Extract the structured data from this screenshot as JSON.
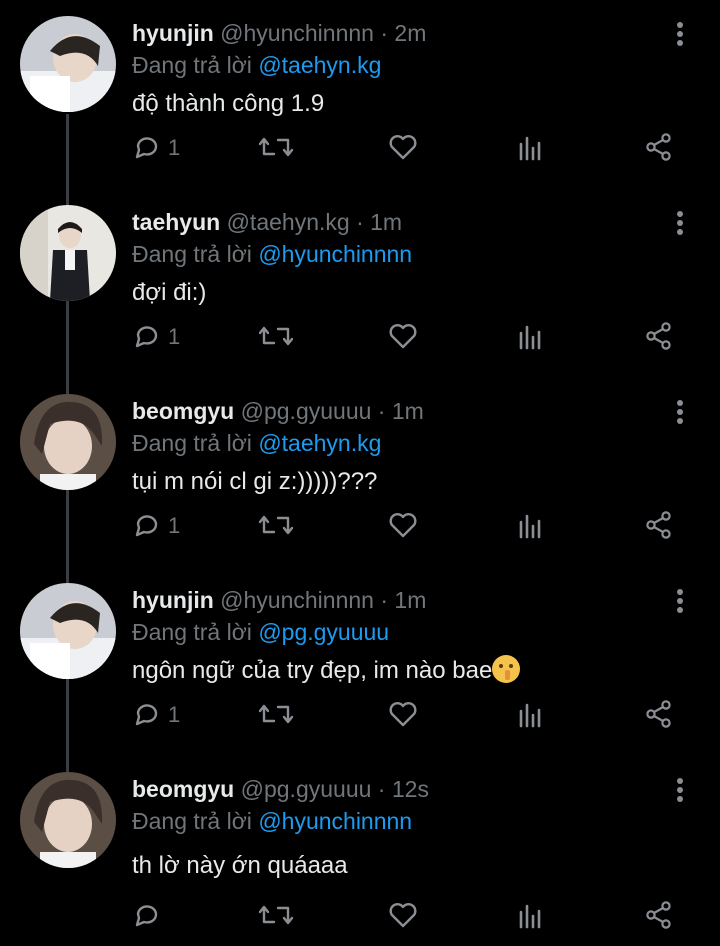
{
  "colors": {
    "background": "#000000",
    "text": "#e7e9ea",
    "muted": "#71767b",
    "mention": "#1d9bf0",
    "thread_line": "#3a3d41"
  },
  "tweets": [
    {
      "name": "hyunjin",
      "handle": "@hyunchinnnn",
      "dot": "·",
      "time": "2m",
      "reply_prefix": "Đang trả lời",
      "reply_to": "@taehyn.kg",
      "text": "độ thành công 1.9",
      "emoji": "",
      "reply_count": "1",
      "avatar": "hyunjin-avatar"
    },
    {
      "name": "taehyun",
      "handle": "@taehyn.kg",
      "dot": "·",
      "time": "1m",
      "reply_prefix": "Đang trả lời",
      "reply_to": "@hyunchinnnn",
      "text": "đợi đi:)",
      "emoji": "",
      "reply_count": "1",
      "avatar": "taehyun-avatar"
    },
    {
      "name": "beomgyu",
      "handle": "@pg.gyuuuu",
      "dot": "·",
      "time": "1m",
      "reply_prefix": "Đang trả lời",
      "reply_to": "@taehyn.kg",
      "text": "tụi m nói cl gi z:)))))???",
      "emoji": "",
      "reply_count": "1",
      "avatar": "beomgyu-avatar"
    },
    {
      "name": "hyunjin",
      "handle": "@hyunchinnnn",
      "dot": "·",
      "time": "1m",
      "reply_prefix": "Đang trả lời",
      "reply_to": "@pg.gyuuuu",
      "text": "ngôn ngữ của try đẹp, im nào bae",
      "emoji": "shushing-face-emoji",
      "reply_count": "1",
      "avatar": "hyunjin-avatar"
    },
    {
      "name": "beomgyu",
      "handle": "@pg.gyuuuu",
      "dot": "·",
      "time": "12s",
      "reply_prefix": "Đang trả lời",
      "reply_to": "@hyunchinnnn",
      "text": "th lờ này ớn quáaaa",
      "emoji": "",
      "reply_count": "",
      "avatar": "beomgyu-avatar"
    }
  ]
}
